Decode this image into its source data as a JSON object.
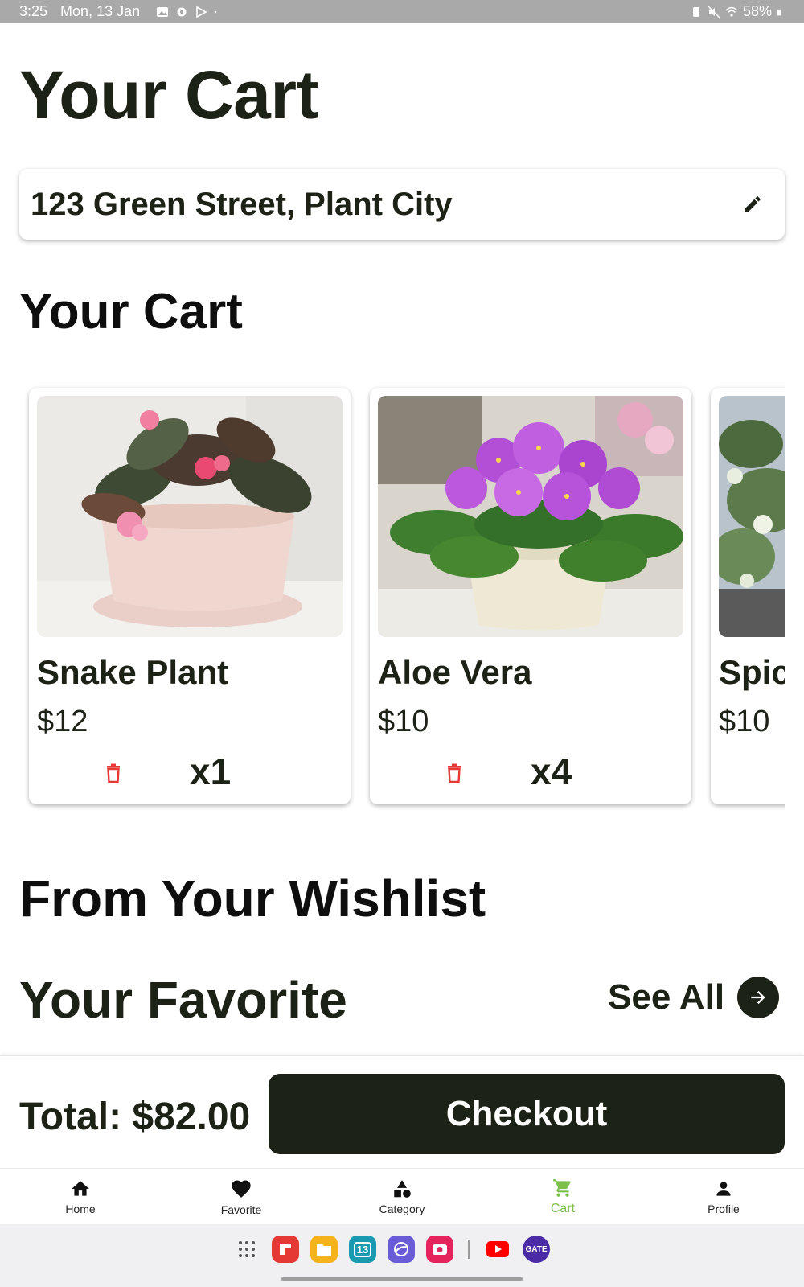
{
  "status_bar": {
    "time": "3:25",
    "date": "Mon, 13 Jan",
    "battery": "58%",
    "icons": [
      "gallery-icon",
      "settings-icon",
      "play-store-icon",
      "dot-icon",
      "battery-saver-icon",
      "mute-icon",
      "wifi-icon",
      "battery-icon"
    ]
  },
  "header": {
    "title": "Your Cart"
  },
  "address": {
    "text": "123 Green Street, Plant City",
    "edit_icon": "pencil-icon"
  },
  "cart": {
    "title": "Your Cart",
    "items": [
      {
        "name": "Snake Plant",
        "price": "$12",
        "quantity": "x1",
        "image": "pink-begonia-in-pot"
      },
      {
        "name": "Aloe Vera",
        "price": "$10",
        "quantity": "x4",
        "image": "purple-african-violet-in-pot"
      },
      {
        "name": "Spic",
        "price": "$10",
        "quantity": "",
        "image": "variegated-ivy"
      }
    ],
    "delete_color": "#e53935"
  },
  "wishlist": {
    "title": "From Your Wishlist",
    "favorites_title": "Your Favorite",
    "see_all": "See All"
  },
  "checkout": {
    "total": "Total: $82.00",
    "button_label": "Checkout"
  },
  "bottom_nav": {
    "items": [
      {
        "label": "Home",
        "icon": "home-icon",
        "active": false
      },
      {
        "label": "Favorite",
        "icon": "heart-icon",
        "active": false
      },
      {
        "label": "Category",
        "icon": "category-icon",
        "active": false
      },
      {
        "label": "Cart",
        "icon": "cart-icon",
        "active": true
      },
      {
        "label": "Profile",
        "icon": "profile-icon",
        "active": false
      }
    ],
    "active_color": "#7cc04b"
  },
  "dock": {
    "calendar_day": "13",
    "gate_label": "GATE",
    "apps": [
      "app-drawer-icon",
      "flipboard-icon",
      "files-icon",
      "calendar-icon",
      "internet-icon",
      "camera-icon",
      "youtube-icon",
      "gate-app-icon"
    ]
  },
  "colors": {
    "primary": "#1c2216",
    "background": "#ffffff",
    "accent": "#7cc04b"
  }
}
